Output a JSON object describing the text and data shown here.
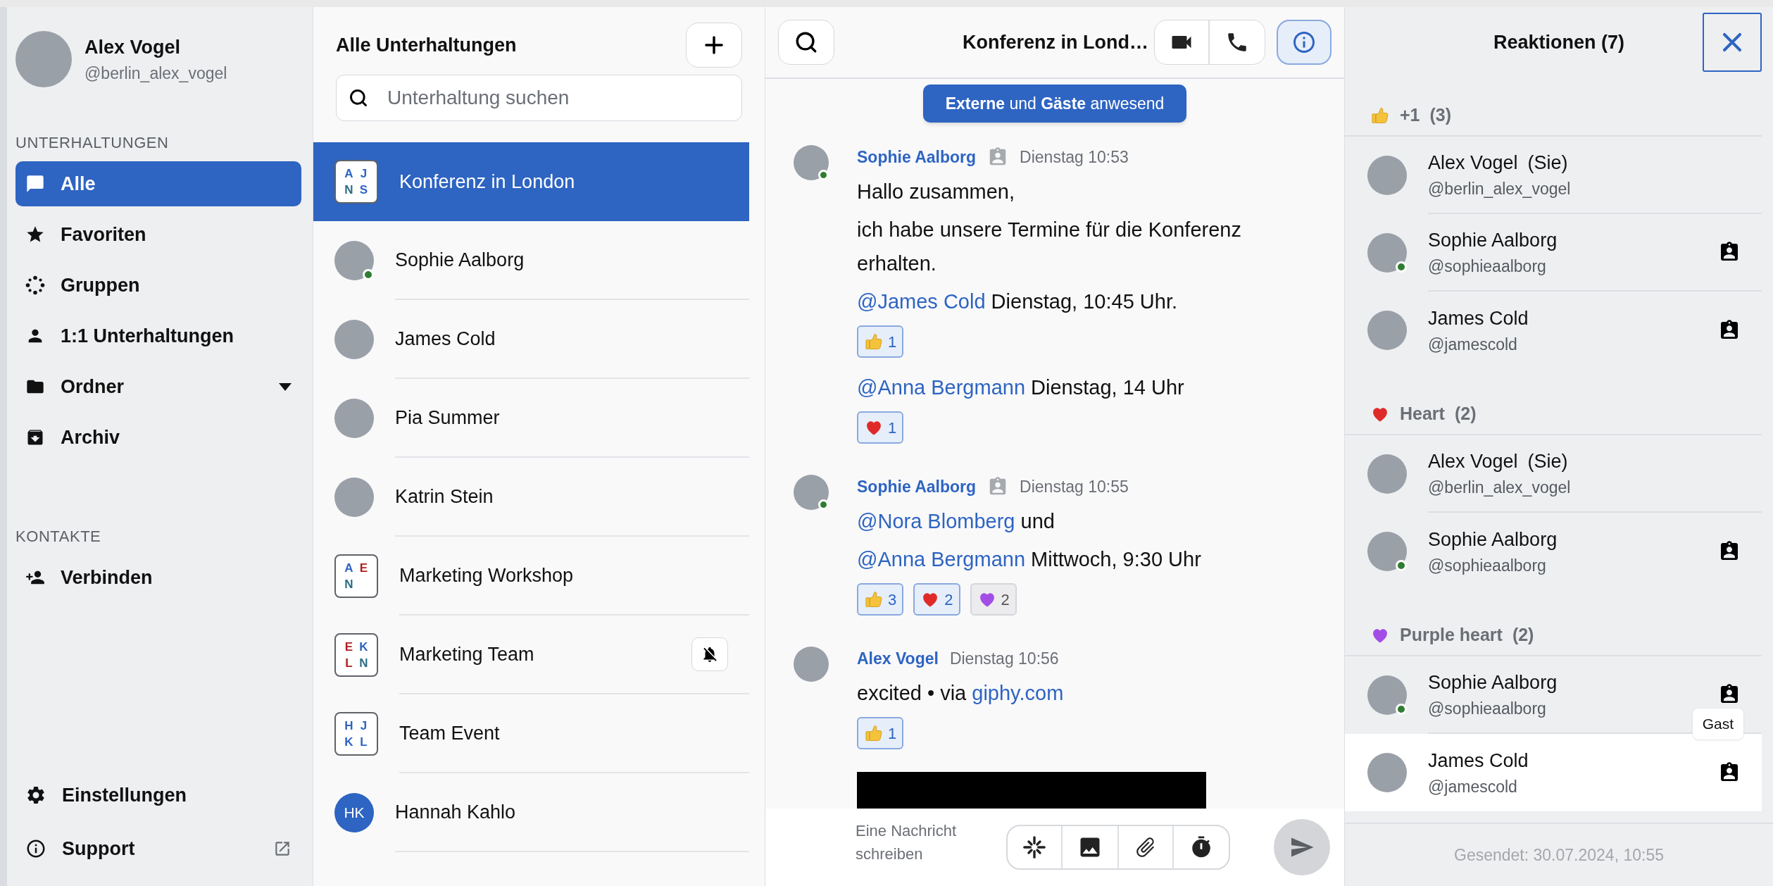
{
  "profile": {
    "name": "Alex Vogel",
    "handle": "@berlin_alex_vogel"
  },
  "sidebar": {
    "sections": [
      {
        "title": "UNTERHALTUNGEN",
        "items": [
          {
            "label": "Alle",
            "selected": true
          },
          {
            "label": "Favoriten",
            "selected": false
          },
          {
            "label": "Gruppen",
            "selected": false
          },
          {
            "label": "1:1 Unterhaltungen",
            "selected": false
          },
          {
            "label": "Ordner",
            "selected": false,
            "dropdown": true
          },
          {
            "label": "Archiv",
            "selected": false
          }
        ]
      },
      {
        "title": "KONTAKTE",
        "items": [
          {
            "label": "Verbinden",
            "selected": false
          }
        ]
      }
    ],
    "bottom": [
      {
        "label": "Einstellungen"
      },
      {
        "label": "Support",
        "external": true
      }
    ]
  },
  "conversations": {
    "title": "Alle Unterhaltungen",
    "search": {
      "placeholder": "Unterhaltung suchen"
    },
    "items": [
      {
        "name": "Konferenz in London",
        "selected": true,
        "muted": false,
        "avatar": {
          "kind": "group",
          "letters": [
            {
              "text": "A",
              "color": "#2e64c2"
            },
            {
              "text": "J",
              "color": "#2e64c2"
            },
            {
              "text": "N",
              "color": "#2c6e85"
            },
            {
              "text": "S",
              "color": "#2e64c2"
            }
          ]
        }
      },
      {
        "name": "Sophie Aalborg",
        "selected": false,
        "muted": false,
        "avatar": {
          "kind": "photo",
          "online": true
        }
      },
      {
        "name": "James Cold",
        "selected": false,
        "muted": false,
        "avatar": {
          "kind": "photo",
          "online": false
        }
      },
      {
        "name": "Pia Summer",
        "selected": false,
        "muted": false,
        "avatar": {
          "kind": "photo",
          "online": false
        }
      },
      {
        "name": "Katrin Stein",
        "selected": false,
        "muted": false,
        "avatar": {
          "kind": "photo",
          "online": false
        }
      },
      {
        "name": "Marketing Workshop",
        "selected": false,
        "muted": false,
        "avatar": {
          "kind": "group",
          "letters": [
            {
              "text": "A",
              "color": "#2e64c2"
            },
            {
              "text": "E",
              "color": "#b01e1e"
            },
            {
              "text": "N",
              "color": "#2c6e85"
            }
          ]
        }
      },
      {
        "name": "Marketing Team",
        "selected": false,
        "muted": true,
        "avatar": {
          "kind": "group",
          "letters": [
            {
              "text": "E",
              "color": "#b01e1e"
            },
            {
              "text": "K",
              "color": "#2e64c2"
            },
            {
              "text": "L",
              "color": "#b01e1e"
            },
            {
              "text": "N",
              "color": "#2c6e85"
            }
          ]
        }
      },
      {
        "name": "Team Event",
        "selected": false,
        "muted": false,
        "avatar": {
          "kind": "group",
          "letters": [
            {
              "text": "H",
              "color": "#2e64c2"
            },
            {
              "text": "J",
              "color": "#2e64c2"
            },
            {
              "text": "K",
              "color": "#2e64c2"
            },
            {
              "text": "L",
              "color": "#2e64c2"
            }
          ]
        }
      },
      {
        "name": "Hannah Kahlo",
        "selected": false,
        "muted": false,
        "avatar": {
          "kind": "initials",
          "initials": "HK"
        }
      }
    ]
  },
  "chat": {
    "title": "Konferenz in Lond…",
    "info_active": true,
    "banner": "**Externe** und **Gäste** anwesend",
    "messages": [
      {
        "author": "Sophie Aalborg",
        "guest": true,
        "online": true,
        "time": "Dienstag 10:53",
        "blocks": [
          {
            "paragraphs": [
              [
                {
                  "kind": "text",
                  "text": "Hallo zusammen,"
                }
              ],
              [
                {
                  "kind": "text",
                  "text": "ich habe unsere Termine für die Konferenz erhalten."
                }
              ]
            ]
          },
          {
            "paragraphs": [
              [
                {
                  "kind": "mention",
                  "text": "@James Cold"
                },
                {
                  "kind": "text",
                  "text": " Dienstag, 10:45 Uhr."
                }
              ]
            ],
            "reactions": [
              {
                "kind": "thumbs_up",
                "count": "1",
                "selected": true
              }
            ]
          },
          {
            "paragraphs": [
              [
                {
                  "kind": "mention",
                  "text": "@Anna Bergmann"
                },
                {
                  "kind": "text",
                  "text": " Dienstag, 14 Uhr"
                }
              ]
            ],
            "reactions": [
              {
                "kind": "heart",
                "count": "1",
                "selected": true
              }
            ]
          }
        ]
      },
      {
        "author": "Sophie Aalborg",
        "guest": true,
        "online": true,
        "time": "Dienstag 10:55",
        "blocks": [
          {
            "paragraphs": [
              [
                {
                  "kind": "mention",
                  "text": "@Nora Blomberg"
                },
                {
                  "kind": "text",
                  "text": " und"
                }
              ],
              [
                {
                  "kind": "mention",
                  "text": "@Anna Bergmann"
                },
                {
                  "kind": "text",
                  "text": " Mittwoch, 9:30 Uhr"
                }
              ]
            ],
            "reactions": [
              {
                "kind": "thumbs_up",
                "count": "3",
                "selected": true
              },
              {
                "kind": "heart",
                "count": "2",
                "selected": true
              },
              {
                "kind": "purple_heart",
                "count": "2",
                "selected": false
              }
            ]
          }
        ]
      },
      {
        "author": "Alex Vogel",
        "guest": false,
        "online": false,
        "time": "Dienstag 10:56",
        "media": true,
        "blocks": [
          {
            "paragraphs": [
              [
                {
                  "kind": "text",
                  "text": "excited • via "
                },
                {
                  "kind": "link",
                  "text": "giphy.com"
                }
              ]
            ],
            "reactions": [
              {
                "kind": "thumbs_up",
                "count": "1",
                "selected": true
              }
            ]
          }
        ]
      }
    ],
    "composer": {
      "placeholder": "Eine Nachricht schreiben"
    }
  },
  "reactions_panel": {
    "title": "Reaktionen (7)",
    "groups": [
      {
        "kind": "thumbs_up",
        "name": "+1",
        "count": "(3)",
        "members": [
          {
            "name": "Alex Vogel",
            "suffix": "(Sie)",
            "handle": "@berlin_alex_vogel",
            "guest": false,
            "online": false,
            "highlighted": false
          },
          {
            "name": "Sophie Aalborg",
            "handle": "@sophieaalborg",
            "guest": true,
            "online": true,
            "highlighted": false
          },
          {
            "name": "James Cold",
            "handle": "@jamescold",
            "guest": true,
            "online": false,
            "highlighted": false
          }
        ]
      },
      {
        "kind": "heart",
        "name": "Heart",
        "count": "(2)",
        "members": [
          {
            "name": "Alex Vogel",
            "suffix": "(Sie)",
            "handle": "@berlin_alex_vogel",
            "guest": false,
            "online": false,
            "highlighted": false
          },
          {
            "name": "Sophie Aalborg",
            "handle": "@sophieaalborg",
            "guest": true,
            "online": true,
            "highlighted": false
          }
        ]
      },
      {
        "kind": "purple_heart",
        "name": "Purple heart",
        "count": "(2)",
        "members": [
          {
            "name": "Sophie Aalborg",
            "handle": "@sophieaalborg",
            "guest": true,
            "online": true,
            "highlighted": false
          },
          {
            "name": "James Cold",
            "handle": "@jamescold",
            "guest": true,
            "online": false,
            "highlighted": true,
            "tooltip": "Gast"
          }
        ]
      }
    ],
    "footer": "Gesendet: 30.07.2024, 10:55"
  }
}
